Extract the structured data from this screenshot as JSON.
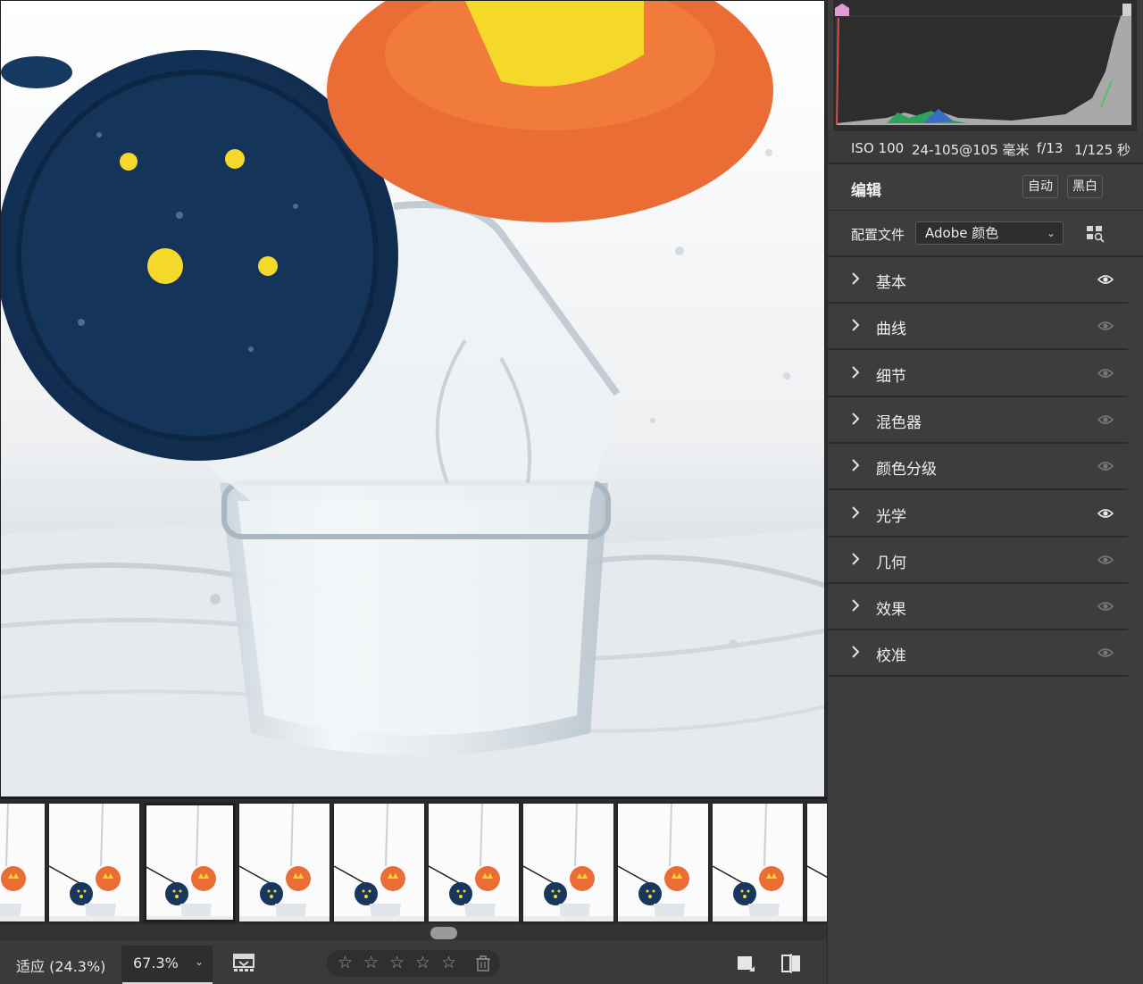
{
  "exif": {
    "iso": "ISO 100",
    "lens": "24-105@105 毫米",
    "aperture": "f/13",
    "shutter": "1/125 秒"
  },
  "edit": {
    "title": "编辑",
    "auto_label": "自动",
    "bw_label": "黑白"
  },
  "profile": {
    "label": "配置文件",
    "value": "Adobe 颜色"
  },
  "sections": [
    {
      "label": "基本",
      "eye": "visible-icon"
    },
    {
      "label": "曲线",
      "eye": "visible-icon-dim"
    },
    {
      "label": "细节",
      "eye": "visible-icon-dim"
    },
    {
      "label": "混色器",
      "eye": "visible-icon-dim"
    },
    {
      "label": "颜色分级",
      "eye": "visible-icon-dim"
    },
    {
      "label": "光学",
      "eye": "visible-icon"
    },
    {
      "label": "几何",
      "eye": "visible-icon-dim"
    },
    {
      "label": "效果",
      "eye": "visible-icon-dim"
    },
    {
      "label": "校准",
      "eye": "visible-icon-dim"
    }
  ],
  "bottom_bar": {
    "zoom_fit": "适应 (24.3%)",
    "zoom_custom": "67.3%",
    "rating_stars": 0,
    "rating_max": 5
  },
  "filmstrip": {
    "thumbnail_count": 9,
    "selected_index": 1
  },
  "colors": {
    "panel_bg": "#3d3d3d",
    "lid_blue": "#17375f",
    "lid_orange": "#ea6d35",
    "accent_yellow": "#f5d92a",
    "histogram_marker": "#e59ad7"
  }
}
